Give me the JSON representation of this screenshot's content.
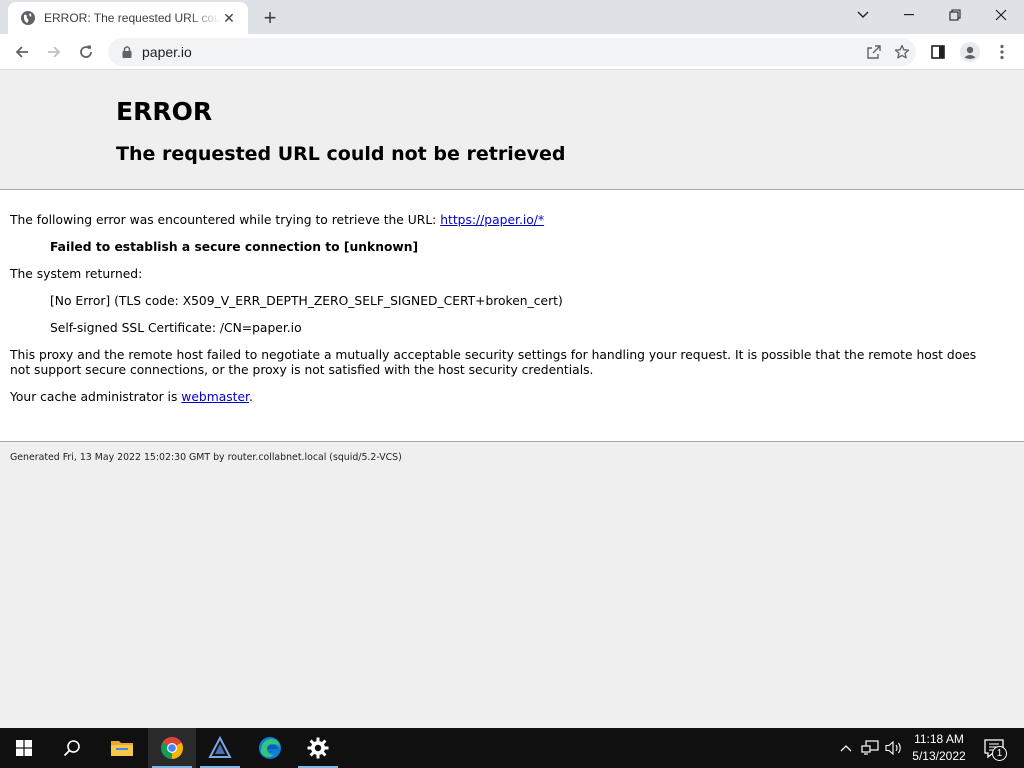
{
  "browser": {
    "tab_title": "ERROR: The requested URL could not be retrieved",
    "tab_close_glyph": "✕",
    "new_tab_glyph": "+",
    "url": "paper.io"
  },
  "page": {
    "h1": "ERROR",
    "h2": "The requested URL could not be retrieved",
    "intro_prefix": "The following error was encountered while trying to retrieve the URL: ",
    "intro_link": "https://paper.io/*",
    "error_title": "Failed to establish a secure connection to [unknown]",
    "system_returned": "The system returned:",
    "error_code": "[No Error] (TLS code: X509_V_ERR_DEPTH_ZERO_SELF_SIGNED_CERT+broken_cert)",
    "cert_info": "Self-signed SSL Certificate: /CN=paper.io",
    "explanation": "This proxy and the remote host failed to negotiate a mutually acceptable security settings for handling your request. It is possible that the remote host does not support secure connections, or the proxy is not satisfied with the host security credentials.",
    "admin_prefix": "Your cache administrator is ",
    "admin_link": "webmaster",
    "admin_suffix": ".",
    "footer": "Generated Fri, 13 May 2022 15:02:30 GMT by router.collabnet.local (squid/5.2-VCS)"
  },
  "taskbar": {
    "time": "11:18 AM",
    "date": "5/13/2022",
    "notification_count": "1",
    "apps": [
      "start-icon",
      "search-icon",
      "file-explorer-icon",
      "chrome-icon",
      "app-icon",
      "edge-icon",
      "settings-icon"
    ]
  },
  "colors": {
    "link": "#0000cc",
    "page_bg": "#efefef",
    "taskbar_bg": "#101010"
  }
}
